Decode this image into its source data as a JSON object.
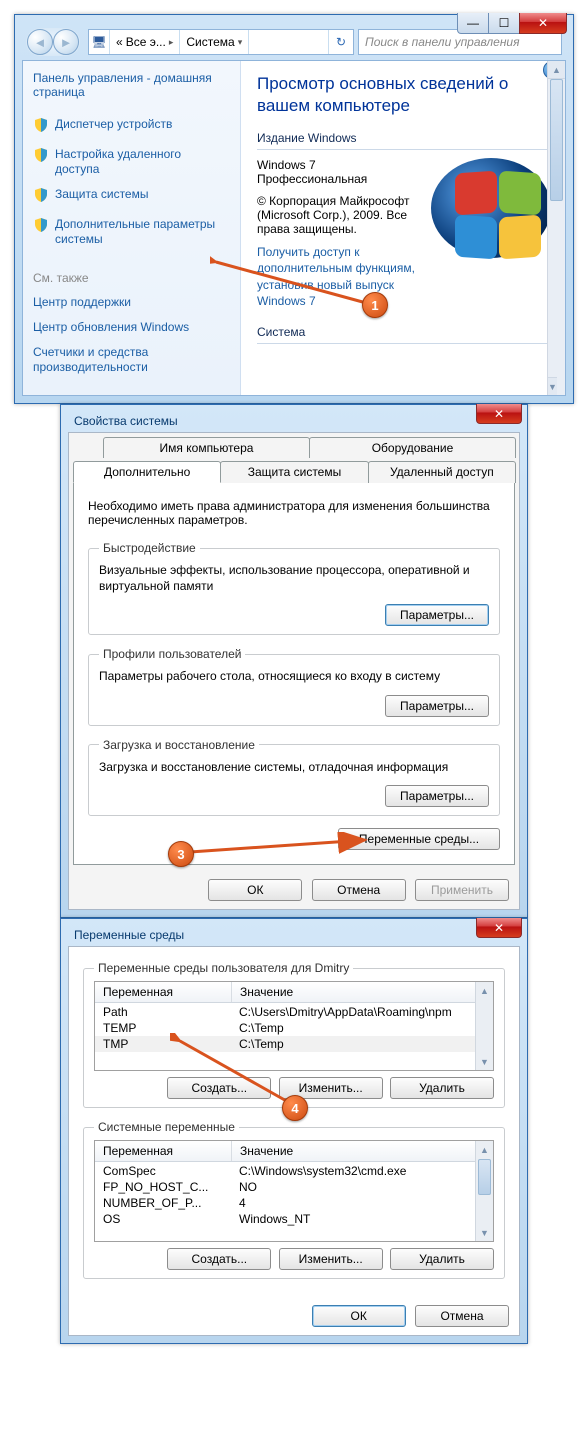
{
  "callouts": {
    "c1": "1",
    "c3": "3",
    "c4": "4"
  },
  "shot1": {
    "breadcrumb": {
      "seg1": "Все э...",
      "seg2": "Система"
    },
    "search_placeholder": "Поиск в панели управления",
    "sidebar": {
      "home": "Панель управления - домашняя страница",
      "items": [
        "Диспетчер устройств",
        "Настройка удаленного доступа",
        "Защита системы",
        "Дополнительные параметры системы"
      ],
      "see_also": "См. также",
      "see_items": [
        "Центр поддержки",
        "Центр обновления Windows",
        "Счетчики и средства производительности"
      ]
    },
    "main": {
      "title": "Просмотр основных сведений о вашем компьютере",
      "edition_label": "Издание Windows",
      "edition_name": "Windows 7 Профессиональная",
      "copyright": "© Корпорация Майкрософт (Microsoft Corp.), 2009. Все права защищены.",
      "more_link": "Получить доступ к дополнительным функциям, установив новый выпуск Windows 7",
      "system_label": "Система"
    }
  },
  "shot2": {
    "title": "Свойства системы",
    "tabs_top": [
      "Имя компьютера",
      "Оборудование"
    ],
    "tabs": [
      "Дополнительно",
      "Защита системы",
      "Удаленный доступ"
    ],
    "note": "Необходимо иметь права администратора для изменения большинства перечисленных параметров.",
    "perf": {
      "legend": "Быстродействие",
      "text": "Визуальные эффекты, использование процессора, оперативной и виртуальной памяти",
      "btn": "Параметры..."
    },
    "prof": {
      "legend": "Профили пользователей",
      "text": "Параметры рабочего стола, относящиеся ко входу в систему",
      "btn": "Параметры..."
    },
    "boot": {
      "legend": "Загрузка и восстановление",
      "text": "Загрузка и восстановление системы, отладочная информация",
      "btn": "Параметры..."
    },
    "env_btn": "Переменные среды...",
    "ok": "ОК",
    "cancel": "Отмена",
    "apply": "Применить"
  },
  "shot3": {
    "title": "Переменные среды",
    "user": {
      "legend": "Переменные среды пользователя для Dmitry",
      "head1": "Переменная",
      "head2": "Значение",
      "rows": [
        {
          "k": "Path",
          "v": "C:\\Users\\Dmitry\\AppData\\Roaming\\npm"
        },
        {
          "k": "TEMP",
          "v": "C:\\Temp"
        },
        {
          "k": "TMP",
          "v": "C:\\Temp"
        }
      ],
      "new": "Создать...",
      "edit": "Изменить...",
      "del": "Удалить"
    },
    "sys": {
      "legend": "Системные переменные",
      "head1": "Переменная",
      "head2": "Значение",
      "rows": [
        {
          "k": "ComSpec",
          "v": "C:\\Windows\\system32\\cmd.exe"
        },
        {
          "k": "FP_NO_HOST_C...",
          "v": "NO"
        },
        {
          "k": "NUMBER_OF_P...",
          "v": "4"
        },
        {
          "k": "OS",
          "v": "Windows_NT"
        }
      ],
      "new": "Создать...",
      "edit": "Изменить...",
      "del": "Удалить"
    },
    "ok": "ОК",
    "cancel": "Отмена"
  }
}
